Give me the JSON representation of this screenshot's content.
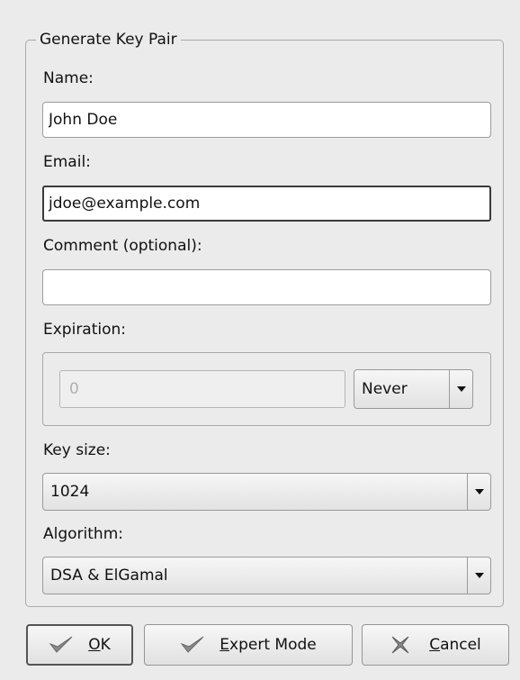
{
  "group": {
    "title": "Generate Key Pair"
  },
  "name": {
    "label": "Name:",
    "value": "John Doe"
  },
  "email": {
    "label": "Email:",
    "value": "jdoe@example.com"
  },
  "comment": {
    "label": "Comment (optional):",
    "value": ""
  },
  "expiration": {
    "label": "Expiration:",
    "value": "0",
    "unit": "Never"
  },
  "key_size": {
    "label": "Key size:",
    "value": "1024"
  },
  "algorithm": {
    "label": "Algorithm:",
    "value": "DSA & ElGamal"
  },
  "buttons": {
    "ok": {
      "accel": "O",
      "rest": "K",
      "icon": "checkmark-icon"
    },
    "expert": {
      "accel": "E",
      "rest": "xpert Mode",
      "icon": "checkmark-icon"
    },
    "cancel": {
      "accel": "C",
      "rest": "ancel",
      "icon": "cross-icon"
    }
  },
  "colors": {
    "background": "#ebebeb",
    "field": "#ffffff",
    "border": "#9d9d9d"
  }
}
